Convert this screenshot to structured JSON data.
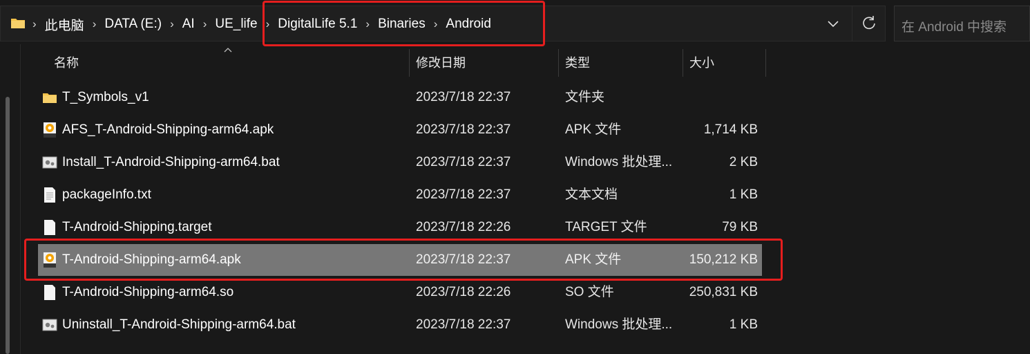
{
  "address": {
    "crumbs": [
      "此电脑",
      "DATA (E:)",
      "AI",
      "UE_life",
      "DigitalLife 5.1",
      "Binaries",
      "Android"
    ],
    "separator": "›"
  },
  "search": {
    "placeholder": "在 Android 中搜索"
  },
  "columns": {
    "name": "名称",
    "date": "修改日期",
    "type": "类型",
    "size": "大小"
  },
  "files": [
    {
      "icon": "folder-icon",
      "name": "T_Symbols_v1",
      "date": "2023/7/18 22:37",
      "type": "文件夹",
      "size": "",
      "selected": false
    },
    {
      "icon": "apk-icon",
      "name": "AFS_T-Android-Shipping-arm64.apk",
      "date": "2023/7/18 22:37",
      "type": "APK 文件",
      "size": "1,714 KB",
      "selected": false
    },
    {
      "icon": "bat-icon",
      "name": "Install_T-Android-Shipping-arm64.bat",
      "date": "2023/7/18 22:37",
      "type": "Windows 批处理...",
      "size": "2 KB",
      "selected": false
    },
    {
      "icon": "txt-icon",
      "name": "packageInfo.txt",
      "date": "2023/7/18 22:37",
      "type": "文本文档",
      "size": "1 KB",
      "selected": false
    },
    {
      "icon": "file-icon",
      "name": "T-Android-Shipping.target",
      "date": "2023/7/18 22:26",
      "type": "TARGET 文件",
      "size": "79 KB",
      "selected": false
    },
    {
      "icon": "apk-icon",
      "name": "T-Android-Shipping-arm64.apk",
      "date": "2023/7/18 22:37",
      "type": "APK 文件",
      "size": "150,212 KB",
      "selected": true
    },
    {
      "icon": "file-icon",
      "name": "T-Android-Shipping-arm64.so",
      "date": "2023/7/18 22:26",
      "type": "SO 文件",
      "size": "250,831 KB",
      "selected": false
    },
    {
      "icon": "bat-icon",
      "name": "Uninstall_T-Android-Shipping-arm64.bat",
      "date": "2023/7/18 22:37",
      "type": "Windows 批处理...",
      "size": "1 KB",
      "selected": false
    }
  ],
  "colors": {
    "background": "#191919",
    "selected_row": "#777777",
    "highlight": "#e51e1e",
    "folder": "#f3c24a"
  }
}
